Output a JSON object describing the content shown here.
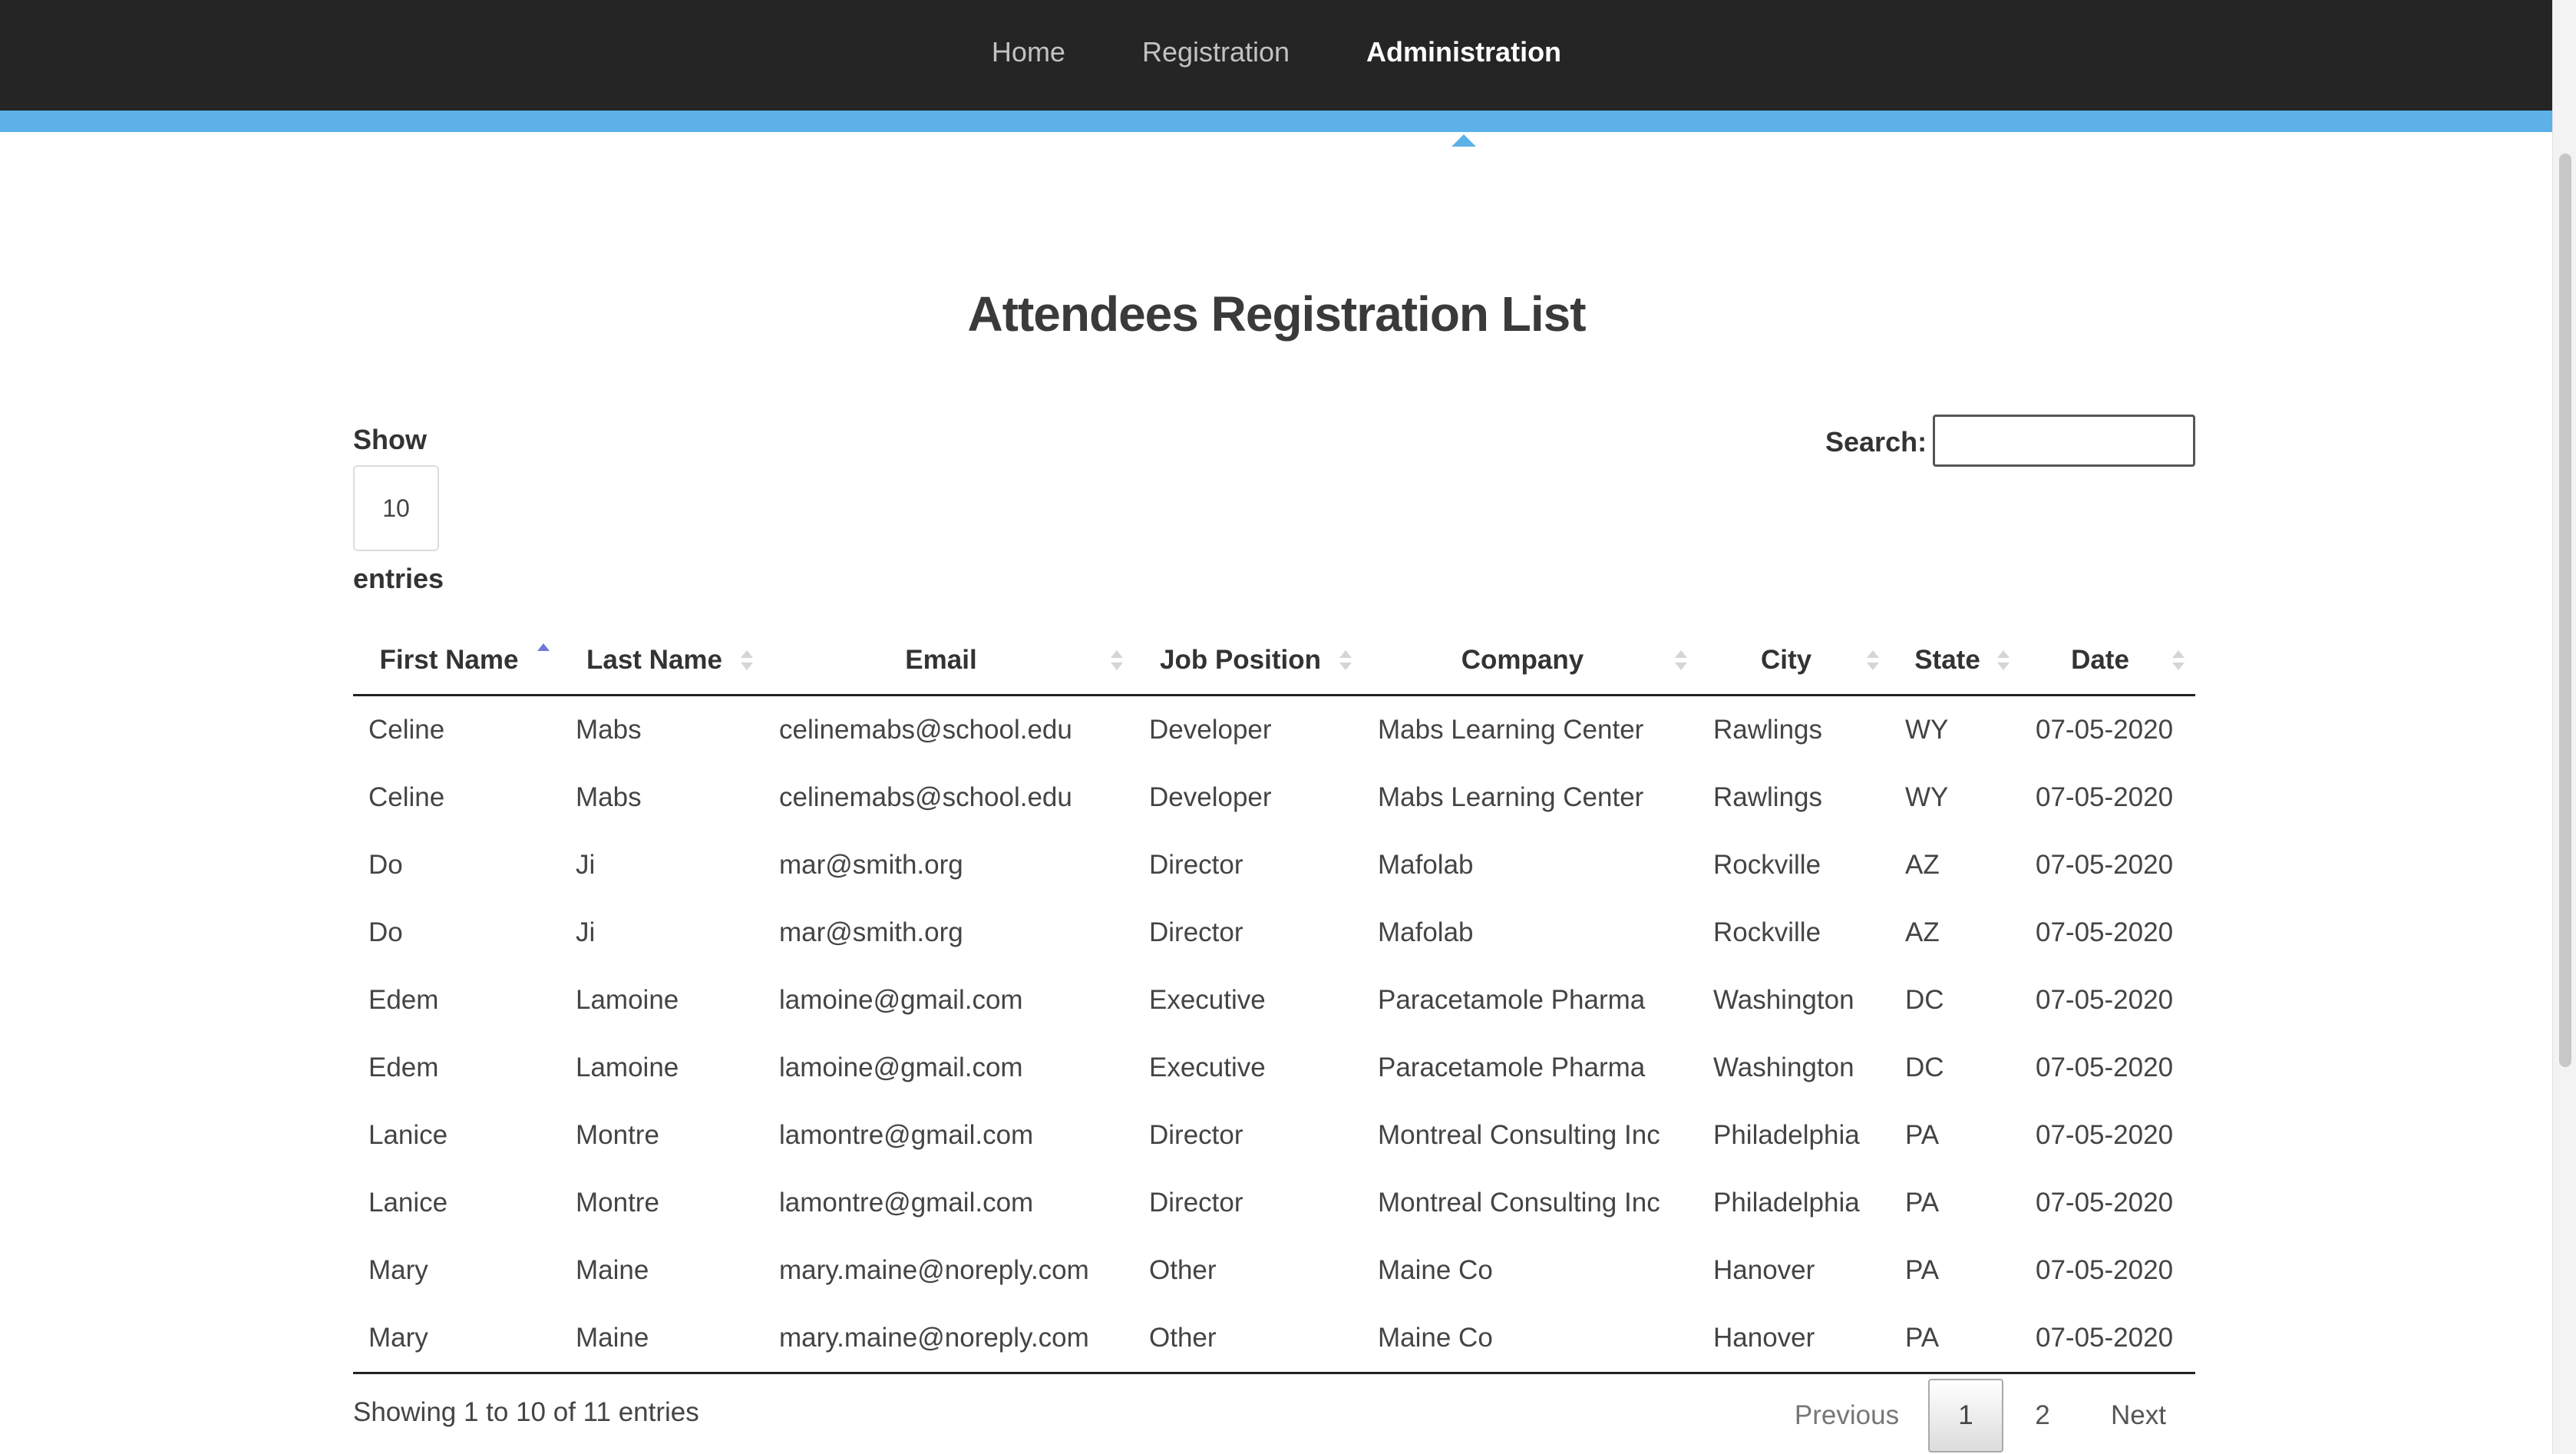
{
  "nav": {
    "items": [
      {
        "label": "Home"
      },
      {
        "label": "Registration"
      },
      {
        "label": "Administration"
      }
    ]
  },
  "page": {
    "title": "Attendees Registration List"
  },
  "length": {
    "show_label": "Show",
    "value": "10",
    "entries_label": "entries"
  },
  "search": {
    "label": "Search:",
    "value": ""
  },
  "table": {
    "columns": [
      "First Name",
      "Last Name",
      "Email",
      "Job Position",
      "Company",
      "City",
      "State",
      "Date"
    ],
    "sorted_column": "First Name",
    "sort_direction": "asc",
    "rows": [
      [
        "Celine",
        "Mabs",
        "celinemabs@school.edu",
        "Developer",
        "Mabs Learning Center",
        "Rawlings",
        "WY",
        "07-05-2020"
      ],
      [
        "Celine",
        "Mabs",
        "celinemabs@school.edu",
        "Developer",
        "Mabs Learning Center",
        "Rawlings",
        "WY",
        "07-05-2020"
      ],
      [
        "Do",
        "Ji",
        "mar@smith.org",
        "Director",
        "Mafolab",
        "Rockville",
        "AZ",
        "07-05-2020"
      ],
      [
        "Do",
        "Ji",
        "mar@smith.org",
        "Director",
        "Mafolab",
        "Rockville",
        "AZ",
        "07-05-2020"
      ],
      [
        "Edem",
        "Lamoine",
        "lamoine@gmail.com",
        "Executive",
        "Paracetamole Pharma",
        "Washington",
        "DC",
        "07-05-2020"
      ],
      [
        "Edem",
        "Lamoine",
        "lamoine@gmail.com",
        "Executive",
        "Paracetamole Pharma",
        "Washington",
        "DC",
        "07-05-2020"
      ],
      [
        "Lanice",
        "Montre",
        "lamontre@gmail.com",
        "Director",
        "Montreal Consulting Inc",
        "Philadelphia",
        "PA",
        "07-05-2020"
      ],
      [
        "Lanice",
        "Montre",
        "lamontre@gmail.com",
        "Director",
        "Montreal Consulting Inc",
        "Philadelphia",
        "PA",
        "07-05-2020"
      ],
      [
        "Mary",
        "Maine",
        "mary.maine@noreply.com",
        "Other",
        "Maine Co",
        "Hanover",
        "PA",
        "07-05-2020"
      ],
      [
        "Mary",
        "Maine",
        "mary.maine@noreply.com",
        "Other",
        "Maine Co",
        "Hanover",
        "PA",
        "07-05-2020"
      ]
    ]
  },
  "footer": {
    "info": "Showing 1 to 10 of 11 entries",
    "pagination": {
      "previous": "Previous",
      "pages": [
        "1",
        "2"
      ],
      "current": "1",
      "next": "Next"
    }
  },
  "colors": {
    "navbar": "#252525",
    "accent": "#5cb1e8",
    "sort_active": "#6f79d8"
  }
}
